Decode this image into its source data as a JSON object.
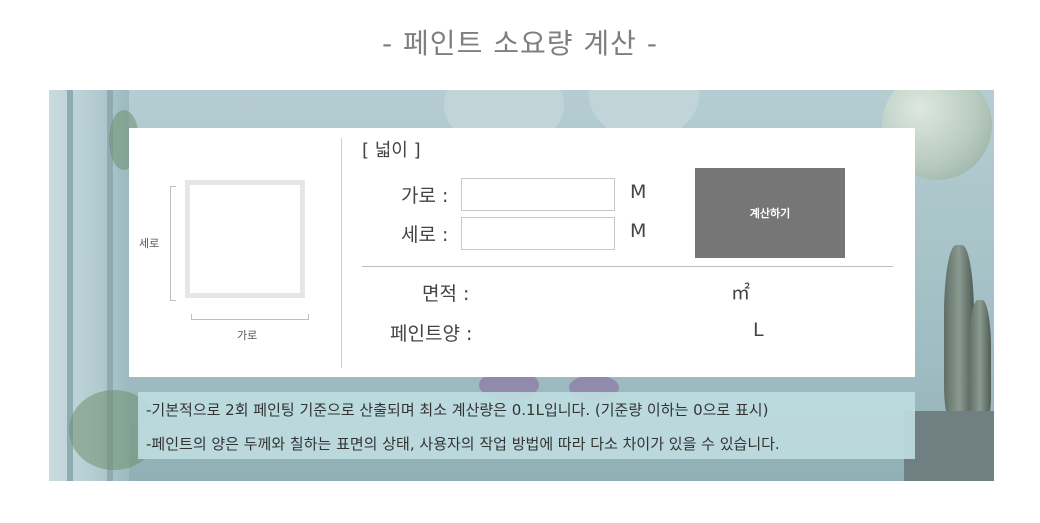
{
  "page": {
    "title": "- 페인트 소요량 계산 -"
  },
  "diagram": {
    "vertical_label": "세로",
    "horizontal_label": "가로"
  },
  "calculator": {
    "section_title": "[ 넓이 ]",
    "width": {
      "label": "가로 :",
      "value": "",
      "unit": "M"
    },
    "height": {
      "label": "세로 :",
      "value": "",
      "unit": "M"
    },
    "button_label": "계산하기",
    "area": {
      "label": "면적 :",
      "value": "",
      "unit": "㎡"
    },
    "paint": {
      "label": "페인트양 :",
      "value": "",
      "unit": "L"
    }
  },
  "notes": [
    "-기본적으로 2회 페인팅 기준으로 산출되며 최소 계산량은 0.1L입니다. (기준량 이하는 0으로 표시)",
    "-페인트의 양은 두께와 칠하는 표면의 상태, 사용자의 작업 방법에 따라 다소 차이가 있을 수 있습니다."
  ],
  "colors": {
    "title": "#7f7f7f",
    "button_bg": "#767676",
    "notes_bg": "#bedce0",
    "hero_bg": "#a8c4c9"
  }
}
